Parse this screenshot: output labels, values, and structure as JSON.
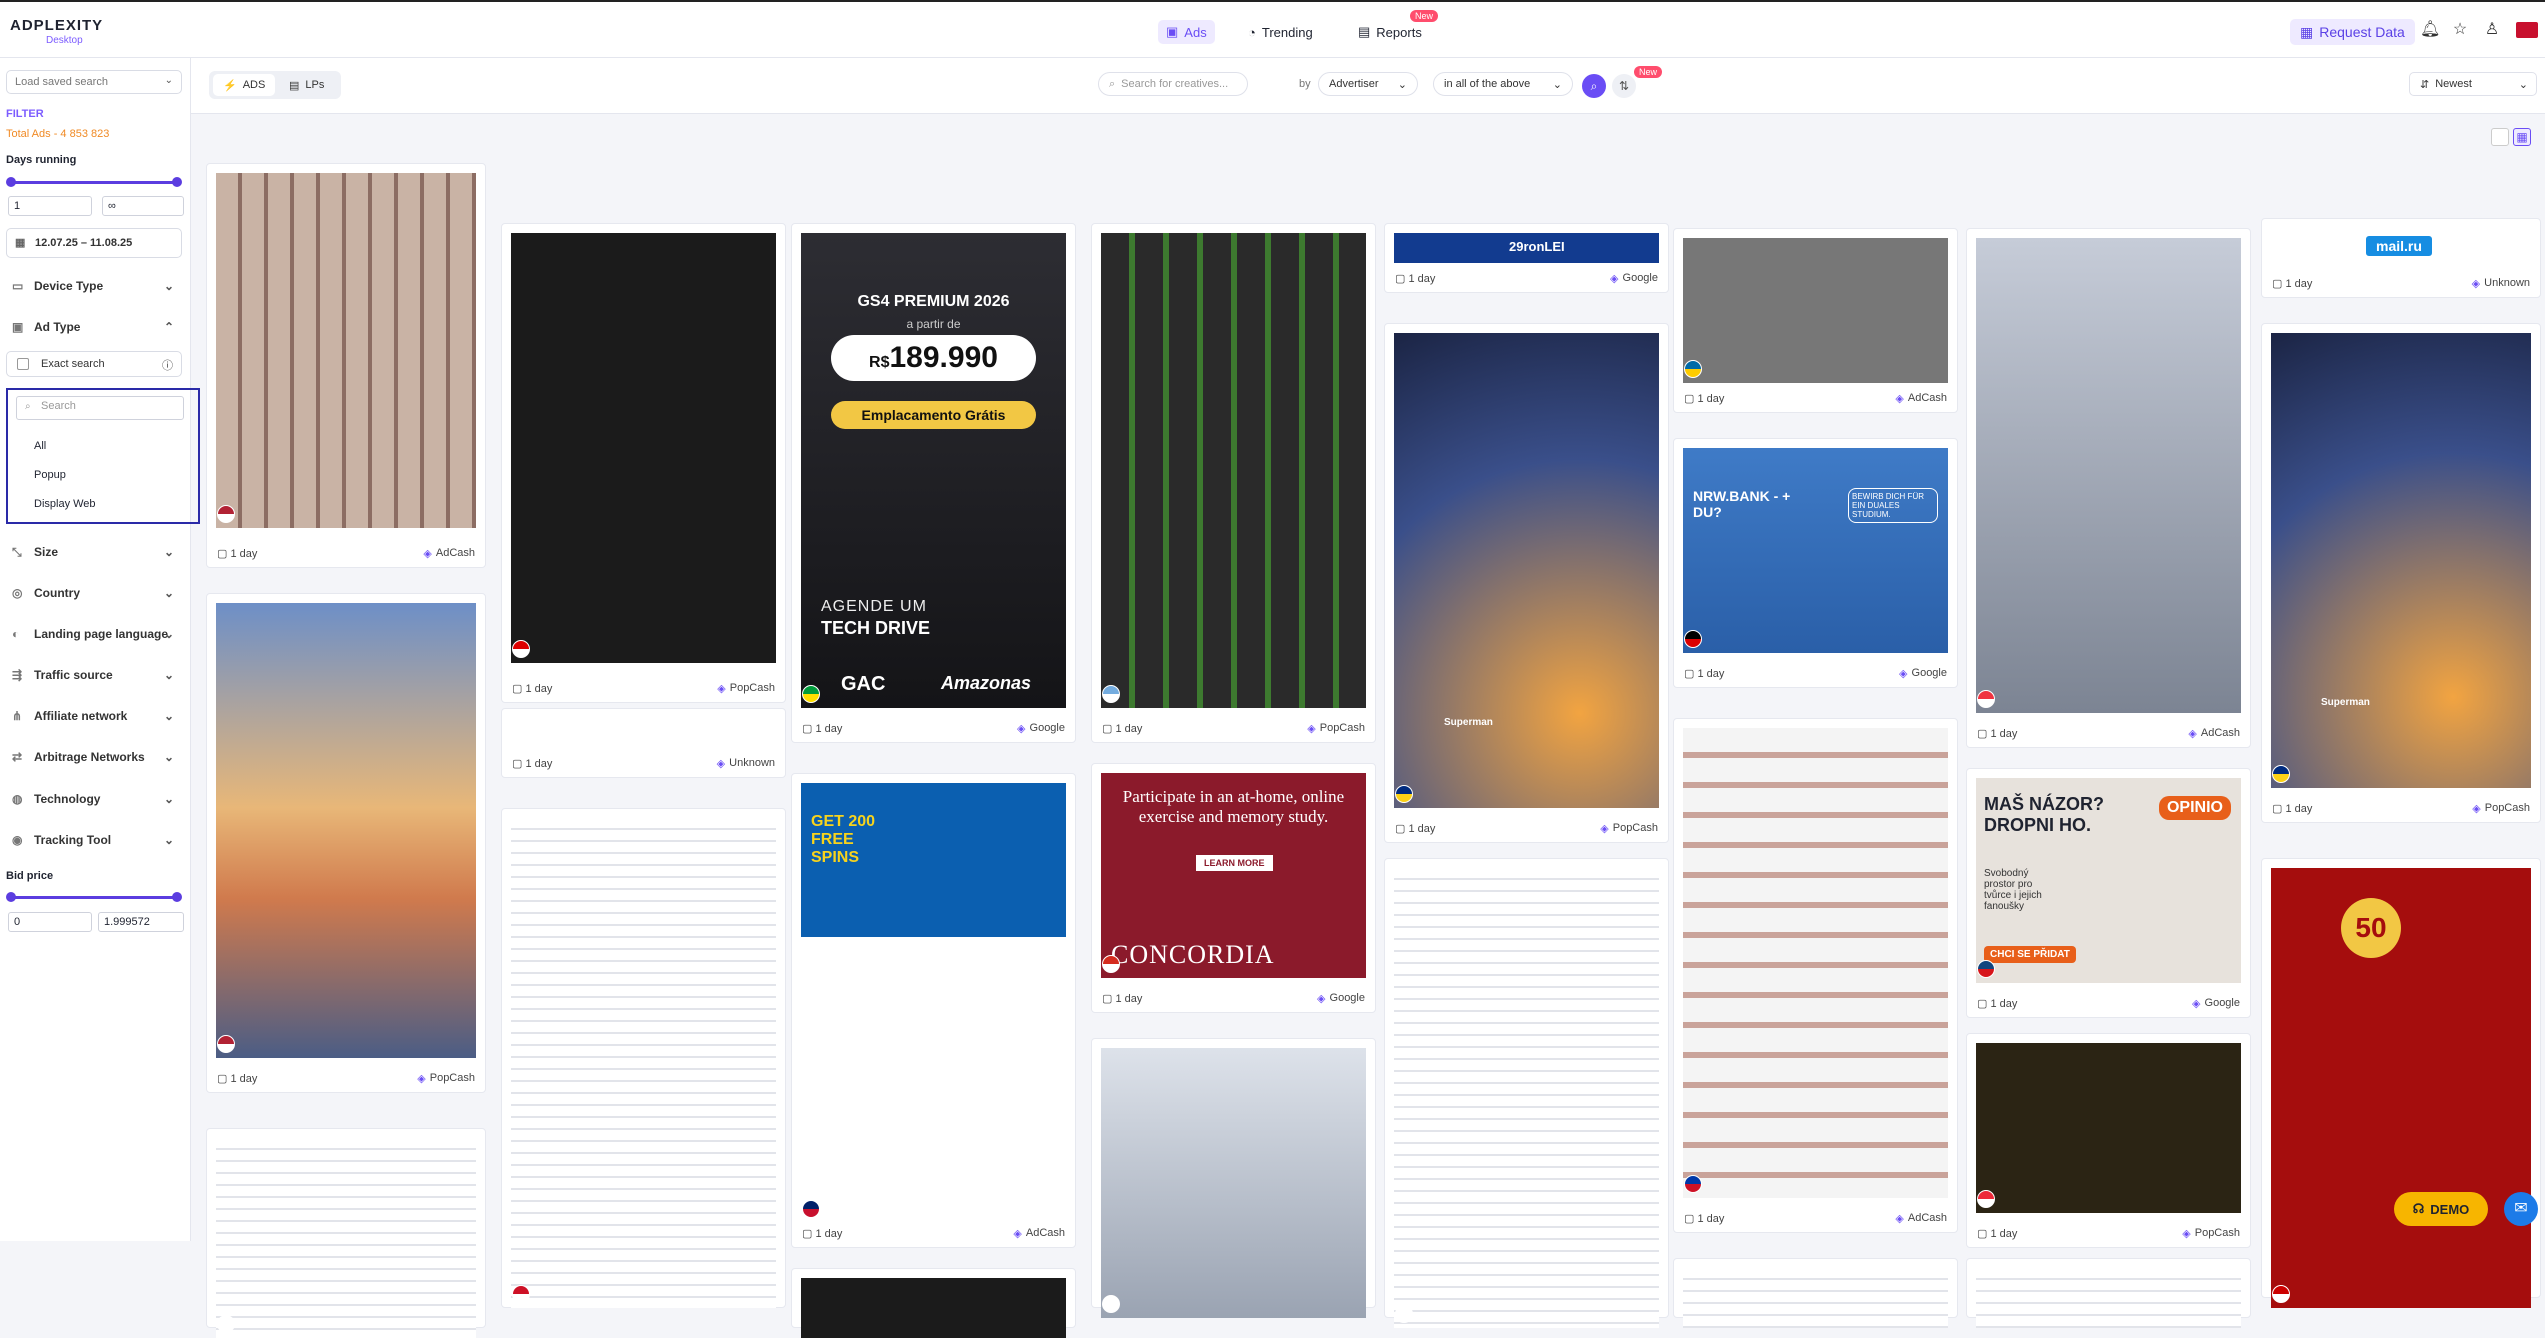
{
  "app": {
    "brand": "ADPLEXITY",
    "edition": "Desktop"
  },
  "nav": {
    "ads": "Ads",
    "trending": "Trending",
    "reports": "Reports",
    "reports_badge": "New"
  },
  "header": {
    "request_data": "Request Data"
  },
  "sidebar": {
    "saved_search_placeholder": "Load saved search",
    "filter_title": "FILTER",
    "total_ads": "Total Ads - 4 853 823",
    "days_running": "Days running",
    "days_min": "1",
    "days_max": "∞",
    "date_range": "12.07.25 – 11.08.25",
    "device_type": "Device Type",
    "ad_type": "Ad Type",
    "exact_search": "Exact search",
    "search_placeholder": "Search",
    "ad_type_options": [
      "All",
      "Popup",
      "Display Web"
    ],
    "sections": [
      "Size",
      "Country",
      "Landing page language",
      "Traffic source",
      "Affiliate network",
      "Arbitrage Networks",
      "Technology",
      "Tracking Tool"
    ],
    "bid_price": "Bid price",
    "bid_min": "0",
    "bid_max": "1.999572"
  },
  "toolbar": {
    "tab_ads": "ADS",
    "tab_lps": "LPs",
    "search_placeholder": "Search for creatives...",
    "by": "by",
    "search_field": "Advertiser",
    "match_mode": "in all of the above",
    "filter_badge": "New",
    "sort": "Newest"
  },
  "colors": {
    "accent": "#6a4df5",
    "brand_purple": "#5b3de0",
    "highlight_border": "#2a2aa8"
  },
  "cards": [
    {
      "days": "1 day",
      "network": "AdCash"
    },
    {
      "days": "1 day",
      "network": "PopCash"
    },
    {
      "days": "1 day",
      "network": "PopCash"
    },
    {
      "days": "1 day",
      "network": "Unknown"
    },
    {
      "days": "1 day",
      "network": "Google"
    },
    {
      "days": "1 day",
      "network": "AdCash"
    },
    {
      "days": "1 day",
      "network": "PopCash"
    },
    {
      "days": "1 day",
      "network": "Google"
    },
    {
      "days": "1 day",
      "network": "Google"
    },
    {
      "days": "1 day",
      "network": "PopCash"
    },
    {
      "days": "1 day",
      "network": "AdCash"
    },
    {
      "days": "1 day",
      "network": "Google"
    },
    {
      "days": "1 day",
      "network": "AdCash"
    },
    {
      "days": "1 day",
      "network": "AdCash"
    },
    {
      "days": "1 day",
      "network": "Google"
    },
    {
      "days": "1 day",
      "network": "PopCash"
    },
    {
      "days": "1 day",
      "network": "Unknown"
    },
    {
      "days": "1 day",
      "network": "PopCash"
    }
  ],
  "creatives": {
    "gac": {
      "line1": "GS4 PREMIUM 2026",
      "line2": "a partir de",
      "price_prefix": "R$",
      "price": "189.990",
      "cta": "Emplacamento Grátis",
      "line3": "AGENDE UM",
      "line4": "TECH DRIVE",
      "brand": "GAC",
      "brand2": "Amazonas"
    },
    "concordia": {
      "text": "Participate in an at-home, online exercise and memory study.",
      "cta": "LEARN MORE",
      "brand": "CONCORDIA"
    },
    "casino": {
      "text": "GET 200 FREE SPINS"
    },
    "nrw": {
      "text": "NRW.BANK - + DU?",
      "sub": "BEWIRB DICH FÜR EIN DUALES STUDIUM."
    },
    "opinio": {
      "text": "MAŠ NÁZOR? DROPNI HO.",
      "brand": "OPINIO",
      "sub": "Svobodný prostor pro tvůrce i jejich fanoušky",
      "cta": "CHCI SE PŘIDAT"
    },
    "mailru": {
      "text": "mail.ru"
    },
    "banner": {
      "text": "29ronLEI"
    },
    "slots": {
      "text": "50"
    },
    "superman": {
      "text": "Superman"
    }
  },
  "demo": "DEMO"
}
